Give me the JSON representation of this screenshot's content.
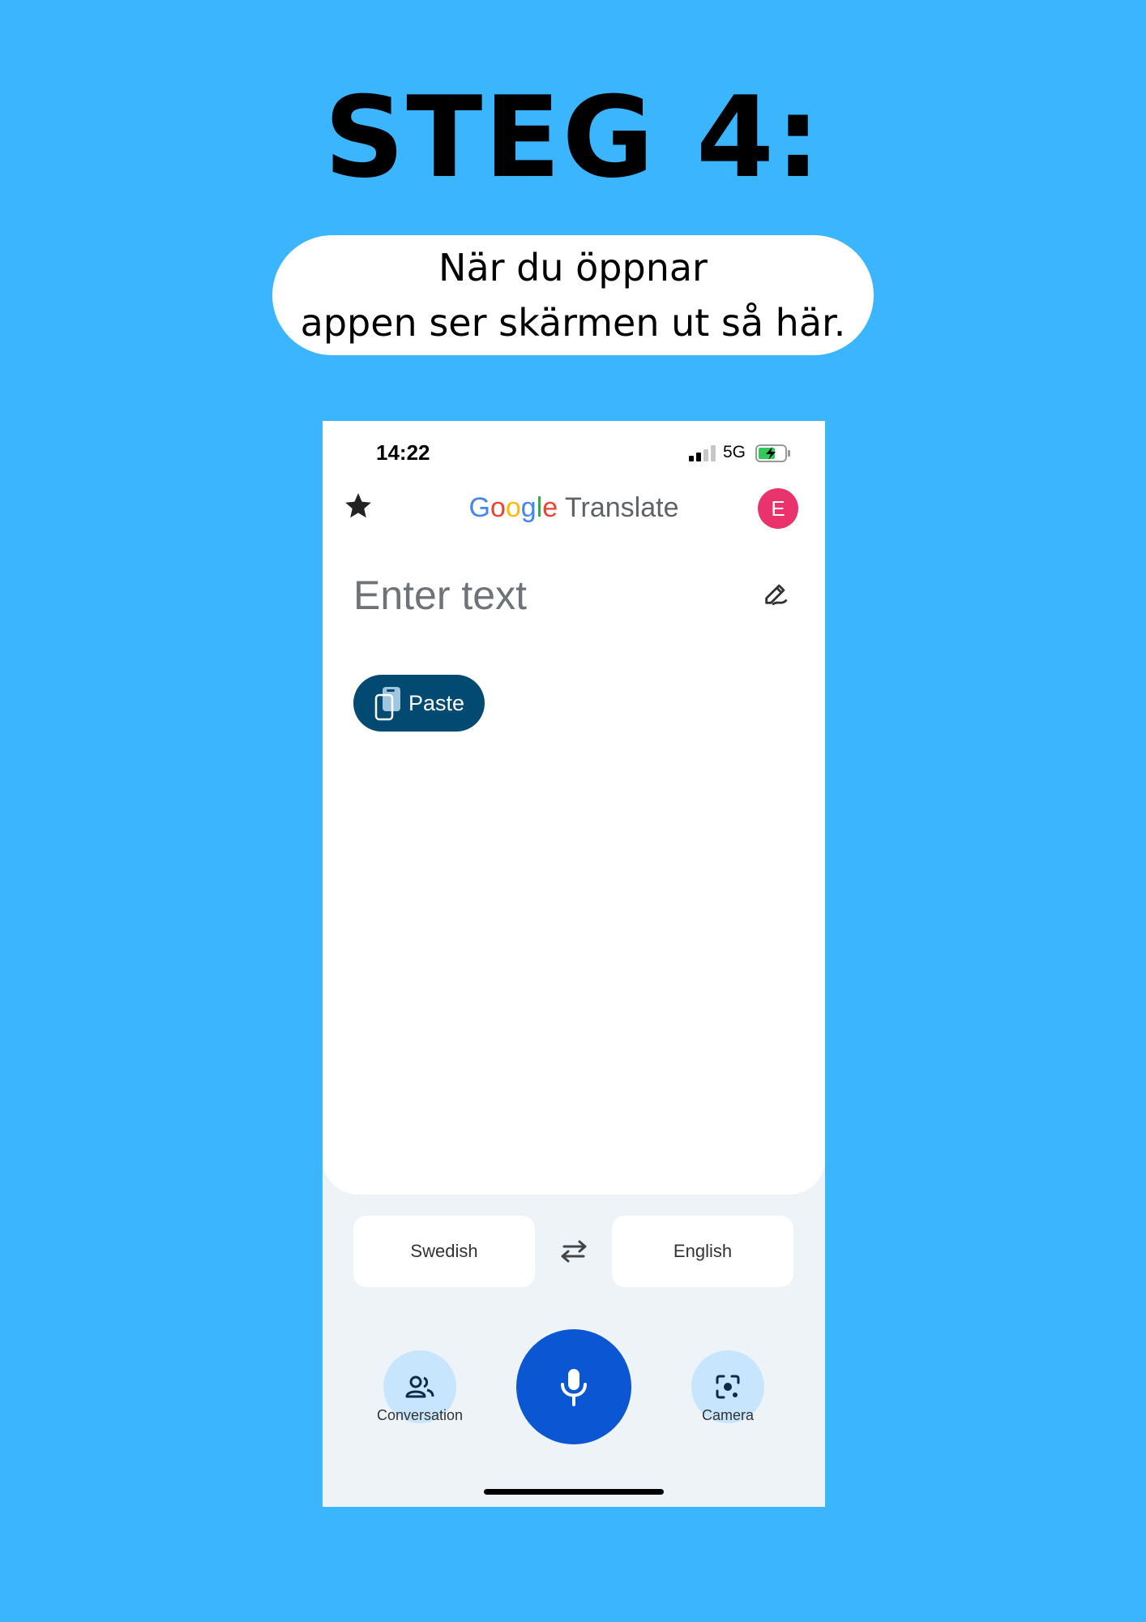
{
  "heading": {
    "title": "STEG 4:",
    "subtitle_line1": "När du öppnar",
    "subtitle_line2": "appen ser skärmen ut så här."
  },
  "status_bar": {
    "time": "14:22",
    "network": "5G"
  },
  "app_bar": {
    "logo_letters": [
      "G",
      "o",
      "o",
      "g",
      "l",
      "e"
    ],
    "logo_suffix": "Translate",
    "avatar_initial": "E",
    "star_icon": "star-icon",
    "avatar_color": "#e8336d"
  },
  "input": {
    "placeholder": "Enter text",
    "handwriting_icon": "handwriting-pen-icon"
  },
  "paste_button": {
    "label": "Paste",
    "icon": "clipboard-icon",
    "color": "#034a73"
  },
  "languages": {
    "source": "Swedish",
    "target": "English",
    "swap_icon": "swap-arrows-icon"
  },
  "bottom_bar": {
    "conversation_label": "Conversation",
    "camera_label": "Camera",
    "mic_icon": "microphone-icon",
    "mic_color": "#0b56d2"
  },
  "colors": {
    "background": "#3bb6fe",
    "accent": "#0b56d2"
  }
}
